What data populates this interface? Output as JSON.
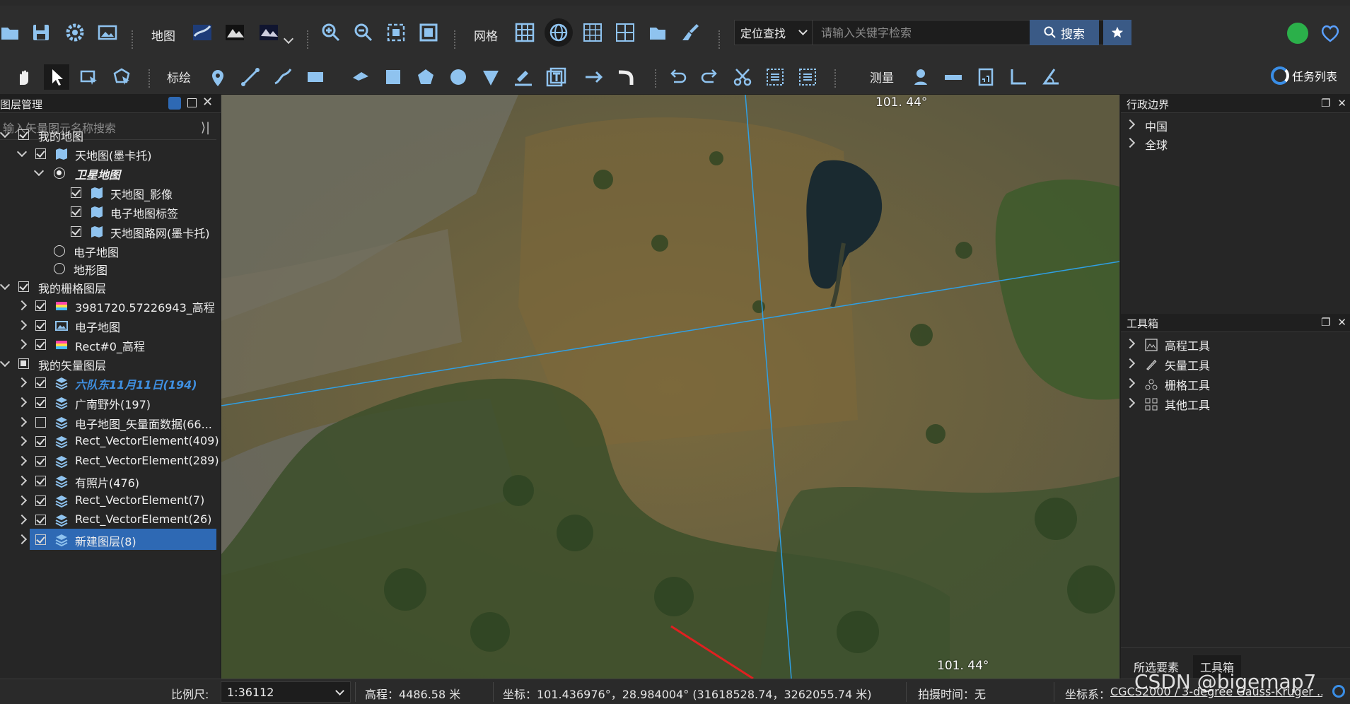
{
  "toolbar1": {
    "map_label": "地图",
    "grid_label": "网格",
    "location_select": "定位查找",
    "search_placeholder": "请输入关键字检索",
    "search_button": "搜索"
  },
  "toolbar2": {
    "draw_label": "标绘",
    "measure_label": "测量",
    "task_list": "任务列表"
  },
  "layer_panel": {
    "title": "图层管理",
    "search_placeholder": "输入矢量图元名称搜索",
    "rows": [
      {
        "label": "我的地图"
      },
      {
        "label": "天地图(墨卡托)"
      },
      {
        "label": "卫星地图"
      },
      {
        "label": "天地图_影像"
      },
      {
        "label": "电子地图标签"
      },
      {
        "label": "天地图路网(墨卡托)"
      },
      {
        "label": "电子地图"
      },
      {
        "label": "地形图"
      },
      {
        "label": "我的栅格图层"
      },
      {
        "label": "3981720.57226943_高程"
      },
      {
        "label": "电子地图"
      },
      {
        "label": "Rect#0_高程"
      },
      {
        "label": "我的矢量图层"
      },
      {
        "label": "六队东11月11日(194)"
      },
      {
        "label": "广南野外(197)"
      },
      {
        "label": "电子地图_矢量面数据(66..."
      },
      {
        "label": "Rect_VectorElement(409)"
      },
      {
        "label": "Rect_VectorElement(289)"
      },
      {
        "label": "有照片(476)"
      },
      {
        "label": "Rect_VectorElement(7)"
      },
      {
        "label": "Rect_VectorElement(26)"
      },
      {
        "label": "新建图层(8)"
      }
    ]
  },
  "map": {
    "grid_label_top": "101. 44°",
    "grid_label_bottom": "101. 44°"
  },
  "admin_panel": {
    "title": "行政边界",
    "items": [
      "中国",
      "全球"
    ]
  },
  "toolbox_panel": {
    "title": "工具箱",
    "items": [
      "高程工具",
      "矢量工具",
      "栅格工具",
      "其他工具"
    ]
  },
  "right_tabs": [
    "所选要素",
    "工具箱"
  ],
  "status": {
    "scale_label": "比例尺:",
    "scale_value": "1:36112",
    "elevation": "高程：4486.58 米",
    "coords": "坐标：101.436976°，28.984004°  (31618528.74，3262055.74 米)",
    "capture_time": "拍摄时间：无",
    "crs_label": "坐标系：",
    "crs_value": "CGCS2000 / 3-degree Gauss-Kruger ..."
  },
  "watermark": "CSDN @bigemap7",
  "colors": {
    "accent": "#3a8ee6",
    "selection": "#2e69b4",
    "grid_line": "#2fa0e6"
  }
}
